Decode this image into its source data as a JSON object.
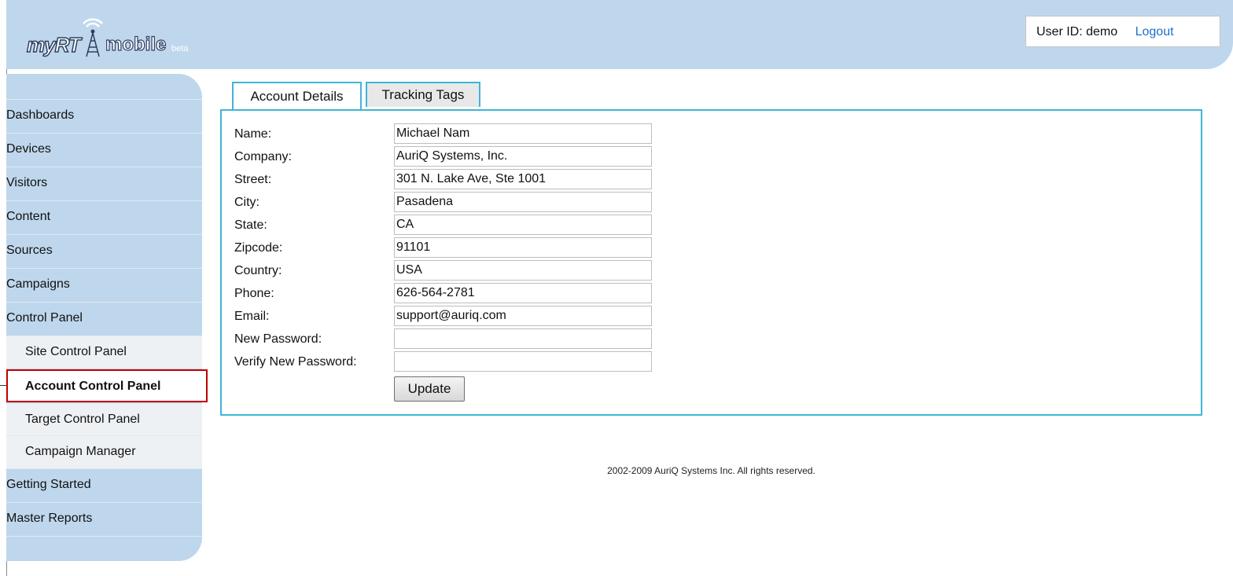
{
  "app": {
    "logo_text_a": "myRT",
    "logo_text_b": "mobile",
    "logo_text_c": "beta"
  },
  "header": {
    "user_label": "User ID: demo",
    "logout_label": "Logout"
  },
  "sidebar": {
    "items": [
      {
        "label": "Dashboards"
      },
      {
        "label": "Devices"
      },
      {
        "label": "Visitors"
      },
      {
        "label": "Content"
      },
      {
        "label": "Sources"
      },
      {
        "label": "Campaigns"
      },
      {
        "label": "Control Panel"
      },
      {
        "label": "Site Control Panel"
      },
      {
        "label": "Account Control Panel"
      },
      {
        "label": "Target Control Panel"
      },
      {
        "label": "Campaign Manager"
      },
      {
        "label": "Getting Started"
      },
      {
        "label": "Master Reports"
      }
    ]
  },
  "tabs": [
    {
      "label": "Account Details"
    },
    {
      "label": "Tracking Tags"
    }
  ],
  "form": {
    "fields": [
      {
        "label": "Name:",
        "value": "Michael Nam"
      },
      {
        "label": "Company:",
        "value": "AuriQ Systems, Inc."
      },
      {
        "label": "Street:",
        "value": "301 N. Lake Ave, Ste 1001"
      },
      {
        "label": "City:",
        "value": "Pasadena"
      },
      {
        "label": "State:",
        "value": "CA"
      },
      {
        "label": "Zipcode:",
        "value": "91101"
      },
      {
        "label": "Country:",
        "value": "USA"
      },
      {
        "label": "Phone:",
        "value": "626-564-2781"
      },
      {
        "label": "Email:",
        "value": "support@auriq.com"
      },
      {
        "label": "New Password:",
        "value": ""
      },
      {
        "label": "Verify New Password:",
        "value": ""
      }
    ],
    "update_label": "Update"
  },
  "footer": {
    "text": "2002-2009 AuriQ Systems Inc. All rights reserved."
  },
  "colors": {
    "header_bg": "#bfd7ec",
    "tab_border": "#3fb5d7",
    "link": "#1b6fcf",
    "highlight": "#c00000"
  }
}
